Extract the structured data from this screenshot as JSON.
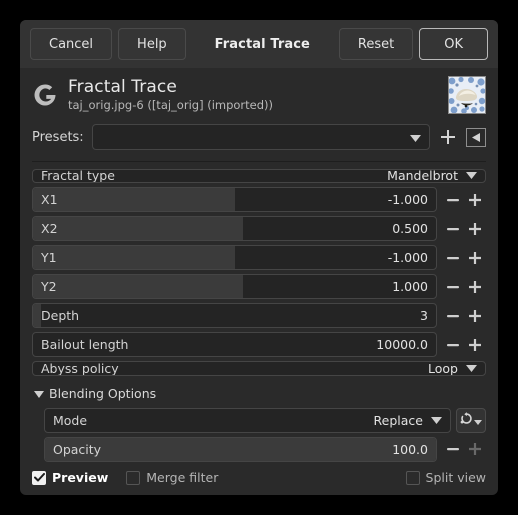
{
  "titlebar": {
    "cancel": "Cancel",
    "help": "Help",
    "title": "Fractal Trace",
    "reset": "Reset",
    "ok": "OK"
  },
  "header": {
    "title": "Fractal Trace",
    "subtitle": "taj_orig.jpg-6 ([taj_orig] (imported))",
    "logo_icon": "gegl-g-logo-icon",
    "thumbnail_icon": "image-thumbnail"
  },
  "presets": {
    "label": "Presets:",
    "value": "",
    "add_icon": "plus-icon",
    "menu_icon": "preset-menu-icon"
  },
  "fractal_type": {
    "label": "Fractal type",
    "value": "Mandelbrot"
  },
  "sliders": [
    {
      "label": "X1",
      "value": "-1.000",
      "fill": 50.0,
      "plus_disabled": false
    },
    {
      "label": "X2",
      "value": "0.500",
      "fill": 52.0,
      "plus_disabled": false
    },
    {
      "label": "Y1",
      "value": "-1.000",
      "fill": 50.0,
      "plus_disabled": false
    },
    {
      "label": "Y2",
      "value": "1.000",
      "fill": 52.0,
      "plus_disabled": false
    },
    {
      "label": "Depth",
      "value": "3",
      "fill": 2.0,
      "plus_disabled": false
    },
    {
      "label": "Bailout length",
      "value": "10000.0",
      "fill": 0.0,
      "plus_disabled": false
    }
  ],
  "abyss_policy": {
    "label": "Abyss policy",
    "value": "Loop"
  },
  "blending": {
    "expander_label": "Blending Options",
    "expanded": true,
    "mode": {
      "label": "Mode",
      "value": "Replace"
    },
    "mode_reset_icon": "reset-rotate-icon",
    "opacity": {
      "label": "Opacity",
      "value": "100.0",
      "fill": 100.0,
      "plus_disabled": true
    }
  },
  "footer": {
    "preview": {
      "label": "Preview",
      "checked": true
    },
    "merge_filter": {
      "label": "Merge filter",
      "checked": false
    },
    "split_view": {
      "label": "Split view",
      "checked": false
    }
  },
  "colors": {
    "dialog_bg": "#2a2a2a",
    "titlebar_bg": "#333333",
    "control_bg": "#242424",
    "fill": "#3b3b3b",
    "text": "#d8d8d8"
  }
}
